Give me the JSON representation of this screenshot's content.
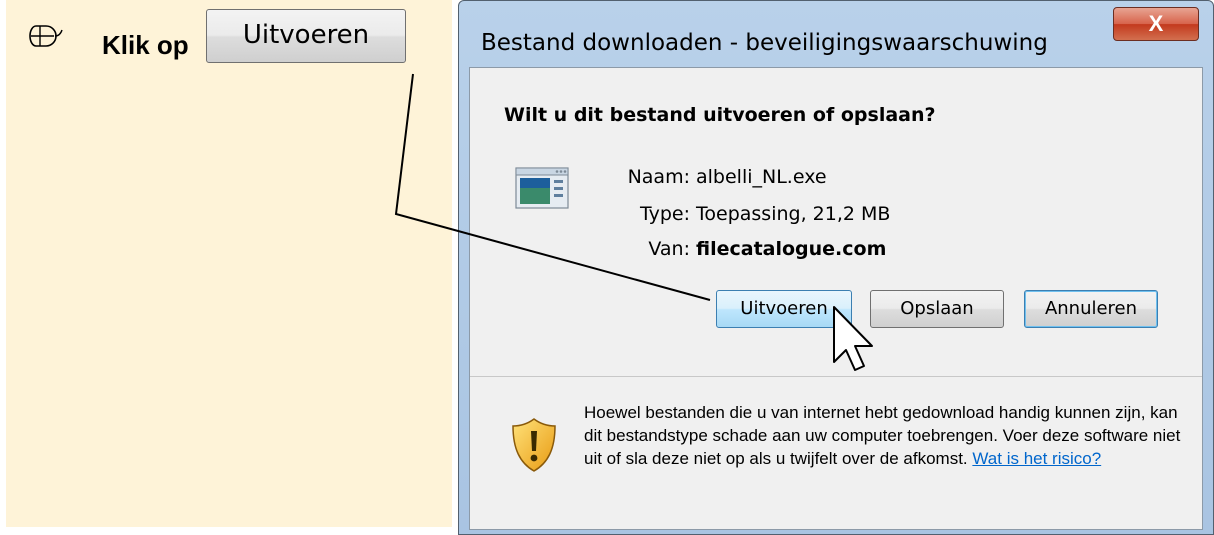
{
  "instruction": {
    "text": "Klik op",
    "button_label": "Uitvoeren",
    "icon": "mouse-icon"
  },
  "dialog": {
    "title": "Bestand downloaden - beveiligingswaarschuwing",
    "close_label": "X",
    "question": "Wilt u dit bestand uitvoeren of opslaan?",
    "fields": {
      "name_label": "Naam:",
      "name_value": "albelli_NL.exe",
      "type_label": "Type:",
      "type_value": "Toepassing, 21,2 MB",
      "from_label": "Van:",
      "from_value": "filecatalogue.com"
    },
    "buttons": {
      "run": "Uitvoeren",
      "save": "Opslaan",
      "cancel": "Annuleren"
    },
    "warning": {
      "text": "Hoewel bestanden die u van internet hebt gedownload handig kunnen zijn, kan dit bestandstype schade aan uw computer toebrengen. Voer deze software niet uit of sla deze niet op als u twijfelt over de afkomst.",
      "link": "Wat is het risico?",
      "icon": "shield-warning-icon"
    }
  },
  "colors": {
    "panel_bg": "#fef3d8",
    "dialog_frame": "#b9d1ea",
    "link": "#0066cc",
    "close_button": "#c3391d"
  }
}
